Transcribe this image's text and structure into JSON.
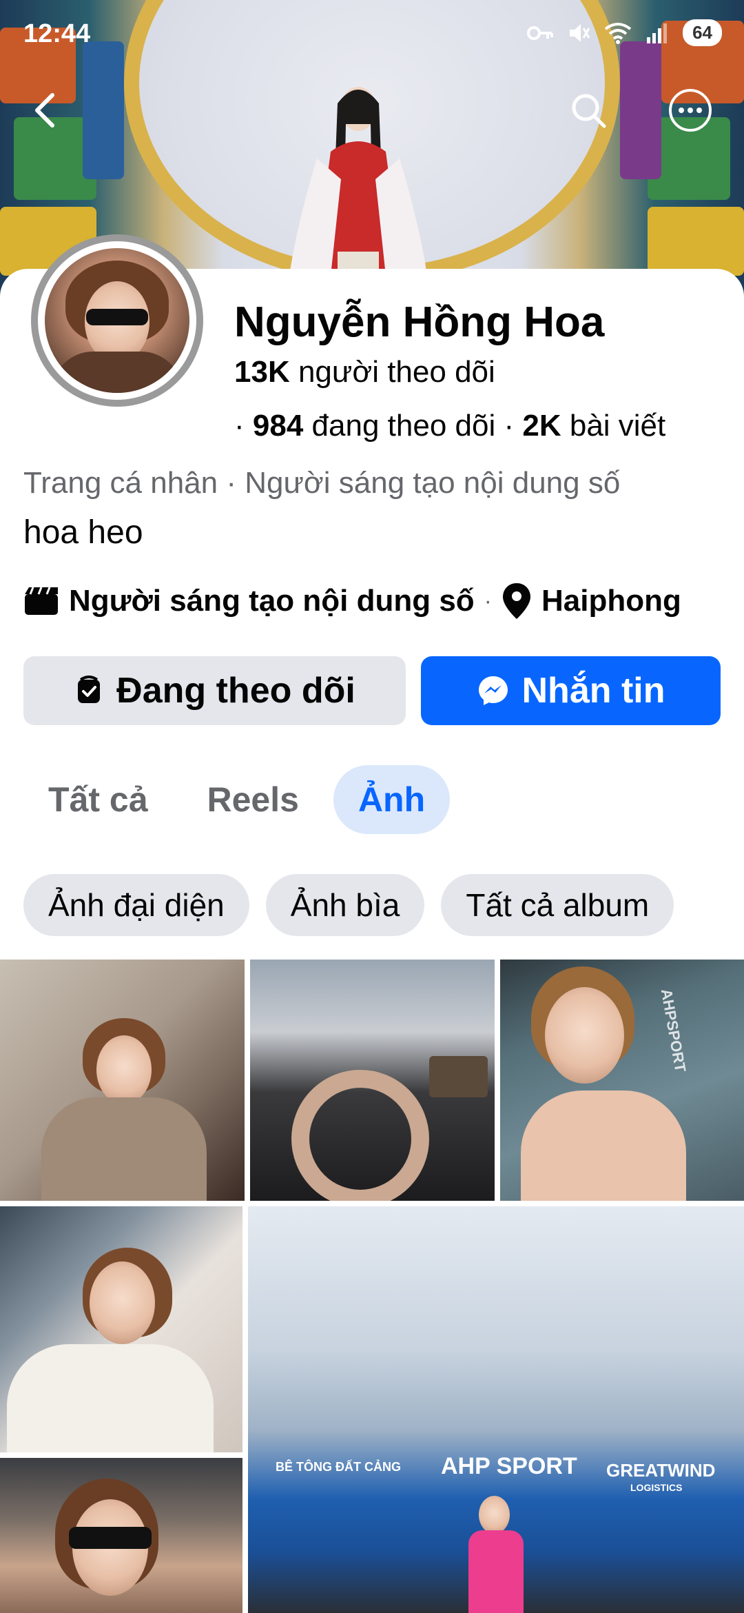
{
  "status_bar": {
    "time": "12:44",
    "battery": "64",
    "icons": [
      "key-icon",
      "mute-icon",
      "wifi-icon",
      "signal-icon",
      "battery-icon"
    ]
  },
  "header": {
    "back_icon": "chevron-left-icon",
    "search_icon": "search-icon",
    "more_icon": "more-horizontal-icon"
  },
  "profile": {
    "name": "Nguyễn Hồng Hoa",
    "followers_count": "13K",
    "followers_label": "người theo dõi",
    "following_prefix": "·",
    "following_count": "984",
    "following_label": "đang theo dõi",
    "posts_prefix": "·",
    "posts_count": "2K",
    "posts_label": "bài viết",
    "category": "Trang cá nhân · Người sáng tạo nội dung số",
    "bio": "hoa heo",
    "detail_role": "Người sáng tạo nội dung số",
    "detail_separator": "·",
    "detail_location": "Haiphong"
  },
  "actions": {
    "follow_label": "Đang theo dõi",
    "message_label": "Nhắn tin"
  },
  "tabs": [
    {
      "label": "Tất cả",
      "active": false
    },
    {
      "label": "Reels",
      "active": false
    },
    {
      "label": "Ảnh",
      "active": true
    }
  ],
  "chips": [
    {
      "label": "Ảnh đại diện"
    },
    {
      "label": "Ảnh bìa"
    },
    {
      "label": "Tất cả album"
    }
  ],
  "photos": {
    "banner_left": "BÊ TÔNG ĐẤT CẢNG",
    "banner_center": "AHP SPORT",
    "banner_right": "GREATWIND",
    "banner_right_sub": "LOGISTICS",
    "court_sign": "AHPSPORT"
  },
  "colors": {
    "accent": "#0866ff",
    "tab_active_bg": "#dbe8fb",
    "chip_bg": "#e4e6eb",
    "secondary_text": "#65676b"
  }
}
